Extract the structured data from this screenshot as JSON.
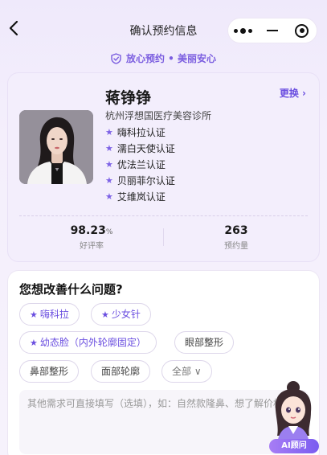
{
  "nav": {
    "title": "确认预约信息"
  },
  "trust_banner": "放心预约 • 美丽安心",
  "doctor": {
    "name": "蒋铮铮",
    "clinic": "杭州浮想国医疗美容诊所",
    "change_label": "更换 ›",
    "certifications": [
      "嗨科拉认证",
      "濡白天使认证",
      "优法兰认证",
      "贝丽菲尔认证",
      "艾维岚认证"
    ],
    "rating_value": "98.23",
    "rating_unit": "%",
    "rating_label": "好评率",
    "booking_count": "263",
    "booking_label": "预约量"
  },
  "question": {
    "title": "您想改善什么问题?",
    "chips": [
      "嗨科拉",
      "少女针",
      "幼态脸（内外轮廓固定）",
      "眼部整形",
      "鼻部整形",
      "面部轮廓",
      "全部 ∨"
    ],
    "input_placeholder": "其他需求可直接填写（选填），如：自然款隆鼻、想了解价格..."
  },
  "ai_assistant": {
    "label": "AI顾问"
  },
  "colors": {
    "accent": "#7b5ee0",
    "background": "#f3eefc"
  }
}
